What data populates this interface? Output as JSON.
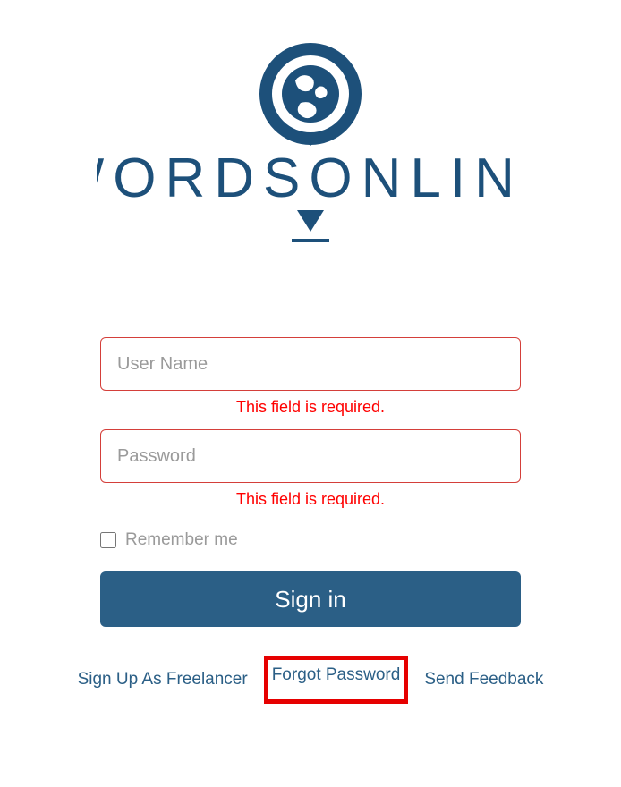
{
  "logo": {
    "text": "WORDSONLINE"
  },
  "form": {
    "username": {
      "placeholder": "User Name",
      "error": "This field is required."
    },
    "password": {
      "placeholder": "Password",
      "error": "This field is required."
    },
    "remember_label": "Remember me",
    "signin_label": "Sign in"
  },
  "links": {
    "signup": "Sign Up As Freelancer",
    "forgot": "Forgot Password",
    "feedback": "Send Feedback"
  },
  "colors": {
    "brand": "#2b5f86",
    "error": "#ff0000",
    "highlight": "#e60000"
  }
}
